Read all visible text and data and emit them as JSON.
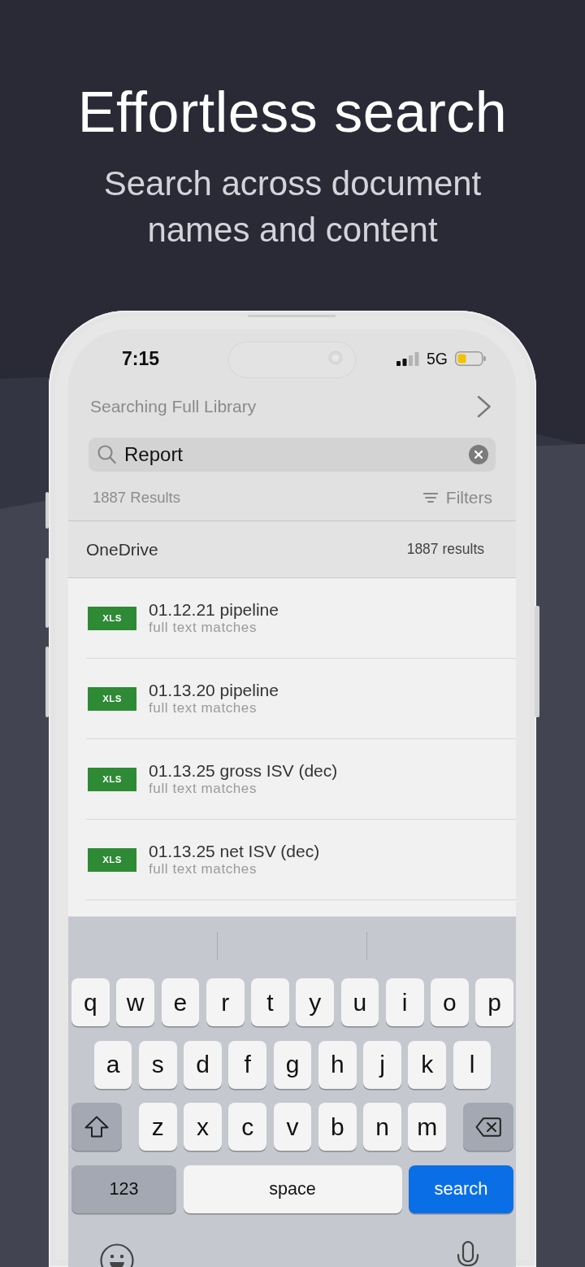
{
  "headline": {
    "title": "Effortless search",
    "subtitle": "Search across document names and content"
  },
  "status_bar": {
    "time": "7:15",
    "network": "5G"
  },
  "search": {
    "scope": "Searching Full Library",
    "value": "Report",
    "results": "1887 Results",
    "filters": "Filters"
  },
  "section": {
    "title": "OneDrive",
    "count": "1887 results"
  },
  "files": [
    {
      "type": "XLS",
      "name": "01.12.21 pipeline",
      "detail": "full text matches"
    },
    {
      "type": "XLS",
      "name": "01.13.20 pipeline",
      "detail": "full text matches"
    },
    {
      "type": "XLS",
      "name": "01.13.25 gross ISV (dec)",
      "detail": "full text matches"
    },
    {
      "type": "XLS",
      "name": "01.13.25 net ISV (dec)",
      "detail": "full text matches"
    }
  ],
  "keyboard": {
    "rows": [
      {
        "keys": [
          {
            "kind": "letter",
            "label": "q"
          },
          {
            "kind": "letter",
            "label": "w"
          },
          {
            "kind": "letter",
            "label": "e"
          },
          {
            "kind": "letter",
            "label": "r"
          },
          {
            "kind": "letter",
            "label": "t"
          },
          {
            "kind": "letter",
            "label": "y"
          },
          {
            "kind": "letter",
            "label": "u"
          },
          {
            "kind": "letter",
            "label": "i"
          },
          {
            "kind": "letter",
            "label": "o"
          },
          {
            "kind": "letter",
            "label": "p"
          }
        ]
      },
      {
        "keys": [
          {
            "kind": "letter",
            "label": "a"
          },
          {
            "kind": "letter",
            "label": "s"
          },
          {
            "kind": "letter",
            "label": "d"
          },
          {
            "kind": "letter",
            "label": "f"
          },
          {
            "kind": "letter",
            "label": "g"
          },
          {
            "kind": "letter",
            "label": "h"
          },
          {
            "kind": "letter",
            "label": "j"
          },
          {
            "kind": "letter",
            "label": "k"
          },
          {
            "kind": "letter",
            "label": "l"
          }
        ]
      },
      {
        "keys": [
          {
            "kind": "shift",
            "on": false
          },
          {
            "kind": "letter",
            "label": "z"
          },
          {
            "kind": "letter",
            "label": "x"
          },
          {
            "kind": "letter",
            "label": "c"
          },
          {
            "kind": "letter",
            "label": "v"
          },
          {
            "kind": "letter",
            "label": "b"
          },
          {
            "kind": "letter",
            "label": "n"
          },
          {
            "kind": "letter",
            "label": "m"
          },
          {
            "kind": "delete"
          }
        ]
      },
      {
        "keys": [
          {
            "kind": "numbers",
            "label": "123"
          },
          {
            "kind": "space",
            "label": "space"
          },
          {
            "kind": "search",
            "label": "search"
          }
        ]
      }
    ]
  }
}
